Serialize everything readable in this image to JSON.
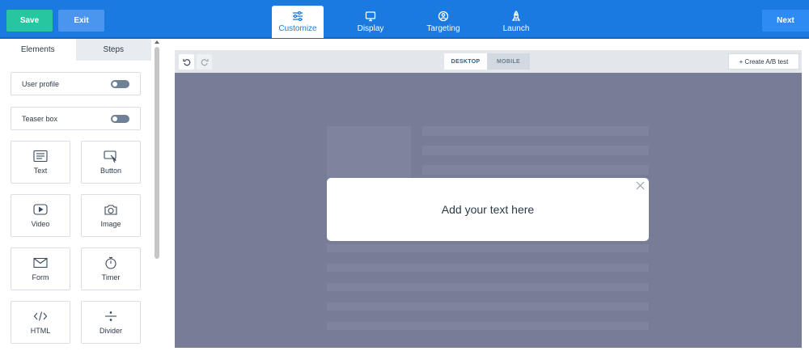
{
  "header": {
    "save_label": "Save",
    "exit_label": "Exit",
    "next_label": "Next",
    "steps": [
      {
        "label": "Customize",
        "icon": "sliders-icon"
      },
      {
        "label": "Display",
        "icon": "monitor-icon"
      },
      {
        "label": "Targeting",
        "icon": "target-user-icon"
      },
      {
        "label": "Launch",
        "icon": "rocket-icon"
      }
    ],
    "active_step": "Customize"
  },
  "sidebar": {
    "tabs": [
      {
        "label": "Elements"
      },
      {
        "label": "Steps"
      }
    ],
    "toggles": [
      {
        "label": "User profile",
        "on": false
      },
      {
        "label": "Teaser box",
        "on": false
      }
    ],
    "elements": [
      {
        "label": "Text",
        "icon": "text-icon"
      },
      {
        "label": "Button",
        "icon": "button-cursor-icon"
      },
      {
        "label": "Video",
        "icon": "video-icon"
      },
      {
        "label": "Image",
        "icon": "camera-icon"
      },
      {
        "label": "Form",
        "icon": "envelope-icon"
      },
      {
        "label": "Timer",
        "icon": "stopwatch-icon"
      },
      {
        "label": "HTML",
        "icon": "code-icon"
      },
      {
        "label": "Divider",
        "icon": "divider-icon"
      }
    ]
  },
  "canvas": {
    "device_tabs": [
      {
        "label": "DESKTOP"
      },
      {
        "label": "MOBILE"
      }
    ],
    "active_device": "DESKTOP",
    "ab_test_label": "+ Create A/B test",
    "popup_text": "Add your text here"
  },
  "colors": {
    "topbar": "#1a7ae0",
    "save": "#26c6a0",
    "preview_overlay": "#777d96"
  }
}
